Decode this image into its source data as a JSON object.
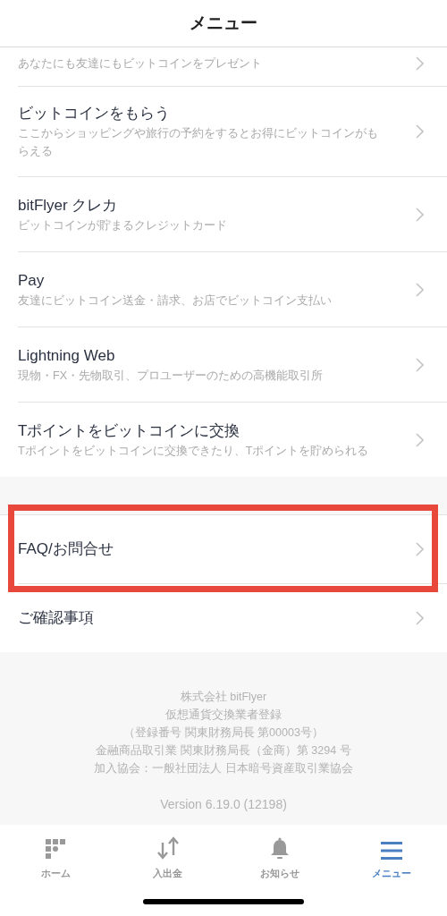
{
  "header": {
    "title": "メニュー"
  },
  "sections": [
    {
      "items": [
        {
          "subtitle": "あなたにも友達にもビットコインをプレゼント",
          "highlighted": false
        },
        {
          "title": "ビットコインをもらう",
          "subtitle": "ここからショッピングや旅行の予約をするとお得にビットコインがもらえる",
          "highlighted": false
        },
        {
          "title": "bitFlyer クレカ",
          "subtitle": "ビットコインが貯まるクレジットカード",
          "highlighted": false
        },
        {
          "title": "Pay",
          "subtitle": "友達にビットコイン送金・請求、お店でビットコイン支払い",
          "highlighted": false
        },
        {
          "title": "Lightning Web",
          "subtitle": "現物・FX・先物取引、プロユーザーのための高機能取引所",
          "highlighted": false
        },
        {
          "title": "Tポイントをビットコインに交換",
          "subtitle": "Tポイントをビットコインに交換できたり、Tポイントを貯められる",
          "highlighted": false
        }
      ]
    },
    {
      "items": [
        {
          "title": "FAQ/お問合せ",
          "highlighted": true
        },
        {
          "title": "ご確認事項",
          "highlighted": false
        }
      ]
    }
  ],
  "footer": {
    "lines": [
      "株式会社 bitFlyer",
      "仮想通貨交換業者登録",
      "（登録番号 関東財務局長 第00003号）",
      "金融商品取引業 関東財務局長（金商）第 3294 号",
      "加入協会：一般社団法人 日本暗号資産取引業協会"
    ],
    "version": "Version 6.19.0 (12198)"
  },
  "tabs": [
    {
      "kind": "home",
      "label": "ホーム",
      "selected": false
    },
    {
      "kind": "transfer",
      "label": "入出金",
      "selected": false
    },
    {
      "kind": "notice",
      "label": "お知らせ",
      "selected": false
    },
    {
      "kind": "menu",
      "label": "メニュー",
      "selected": true
    }
  ]
}
